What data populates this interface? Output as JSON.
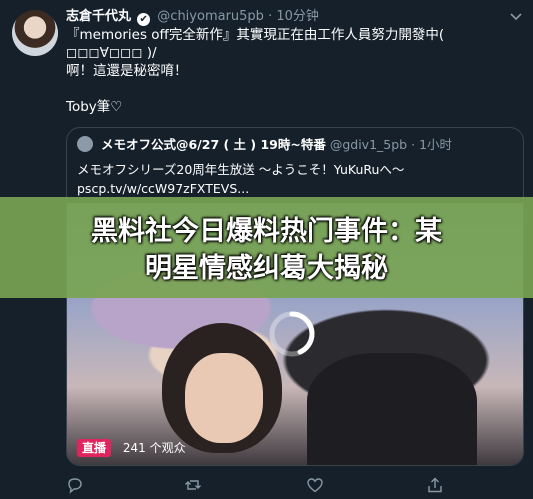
{
  "tweet": {
    "display_name": "志倉千代丸",
    "handle": "@chiyomaru5pb",
    "separator": "·",
    "time": "10分钟",
    "lines": [
      "『memories off完全新作』其實現正在由工作人員努力開發中( ◻◻◻∀◻◻◻ )/",
      "啊！這還是秘密唷！",
      "",
      "Toby筆♡"
    ]
  },
  "quote": {
    "display_name": "メモオフ公式@6/27 ( 土 ) 19時~特番",
    "handle": "@gdiv1_5pb",
    "separator": "·",
    "time": "1小时",
    "lines": [
      "メモオフシリーズ20周年生放送 ～ようこそ！YuKuRuへ～",
      "pscp.tv/w/ccW97zFXTEVS..."
    ],
    "live_badge": "直播",
    "viewers": "241 个观众"
  },
  "banner": {
    "title_line1": "黑料社今日爆料热门事件：某",
    "title_line2": "明星情感纠葛大揭秘"
  },
  "colors": {
    "background": "#15202b",
    "secondary_text": "#8899a6",
    "border": "#38444d",
    "live": "#e0245e",
    "banner": "#78a452"
  },
  "icons": [
    "verified-icon",
    "chevron-down-icon",
    "reply-icon",
    "retweet-icon",
    "like-icon",
    "share-icon",
    "loading-spinner-icon"
  ]
}
